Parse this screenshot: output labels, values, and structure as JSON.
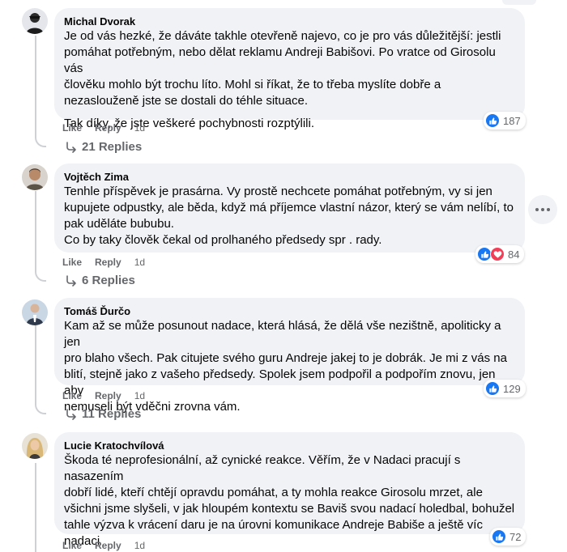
{
  "actions": {
    "like_label": "Like",
    "reply_label": "Reply"
  },
  "comments": [
    {
      "author": "Michal Dvorak",
      "text": "Je od vás hezké, že dáváte takhle otevřeně najevo, co je pro vás důležitější: jestli\npomáhat potřebným, nebo dělat reklamu Andreji Babišovi. Po vratce od Girosolu vás\nčlověku mohlo být trochu líto. Mohl si říkat, že to třeba myslíte dobře a\nnezaslouženě jste se dostali do téhle situace.",
      "text2": "Tak díky, že jste veškeré pochybnosti rozptýlili.",
      "time": "1d",
      "reactions": "187",
      "replies": "21 Replies"
    },
    {
      "author": "Vojtěch Zima",
      "text": "Tenhle příspěvek je prasárna. Vy prostě nechcete pomáhat potřebným, vy si jen\nkupujete odpustky, ale běda, když má příjemce vlastní názor, který se vám nelíbí, to\npak uděláte bububu.\nCo by taky člověk čekal od prolhaného předsedy spr . rady.",
      "time": "1d",
      "reactions": "84",
      "replies": "6 Replies"
    },
    {
      "author": "Tomáš Ďurčo",
      "text": "Kam až se může posunout nadace, která hlásá, že dělá vše nezištně, apoliticky a jen\npro blaho všech. Pak citujete svého guru Andreje jakej to je dobrák. Je mi z vás na\nblití, stejně jako z vašeho předsedy. Spolek jsem podpořil a podpořím znovu, jen aby\nnemuseli být vděčni zrovna vám.",
      "time": "1d",
      "reactions": "129",
      "replies": "11 Replies"
    },
    {
      "author": "Lucie Kratochvílová",
      "text": "Škoda té neprofesionální, až cynické reakce. Věřím, že v Nadaci pracují s nasazením\ndobří lidé, kteří chtějí opravdu pomáhat, a ty mohla reakce Girosolu mrzet, ale\nvšichni jsme slyšeli, v jak hloupém kontextu se Baviš svou nadací holedbal, bohužel\ntahle výzva k vrácení daru je na úrovni komunikace Andreje Babiše a ještě víc nadaci\npoškozuje.",
      "time": "1d",
      "reactions": "72"
    }
  ]
}
